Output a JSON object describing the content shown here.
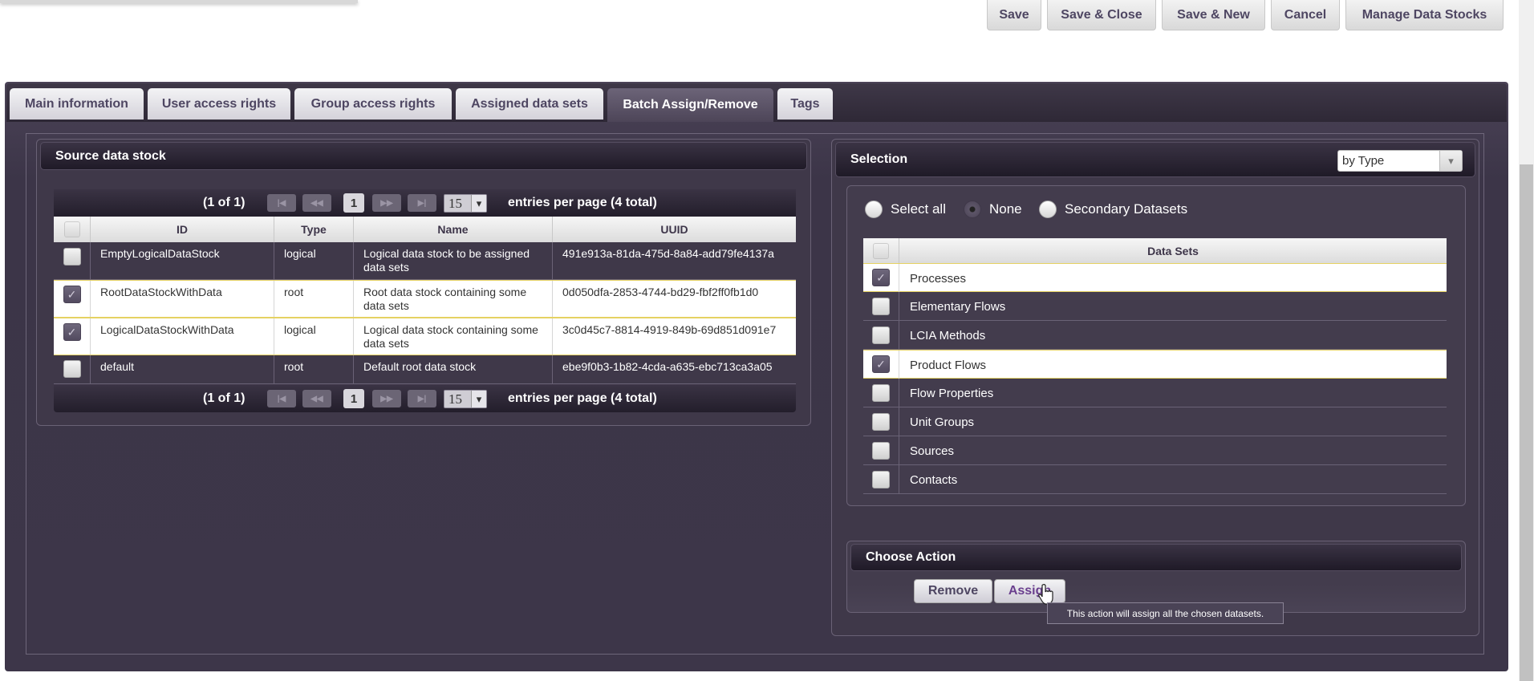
{
  "toolbar": {
    "save": "Save",
    "save_close": "Save & Close",
    "save_new": "Save & New",
    "cancel": "Cancel",
    "manage": "Manage Data Stocks"
  },
  "tabs": [
    "Main information",
    "User access rights",
    "Group access rights",
    "Assigned data sets",
    "Batch Assign/Remove",
    "Tags"
  ],
  "active_tab": "Batch Assign/Remove",
  "source": {
    "title": "Source data stock",
    "pager": {
      "status": "(1 of 1)",
      "page": "1",
      "per_page": "15",
      "summary": "entries per page (4 total)"
    },
    "columns": [
      "ID",
      "Type",
      "Name",
      "UUID"
    ],
    "rows": [
      {
        "id": "EmptyLogicalDataStock",
        "type": "logical",
        "name": "Logical data stock to be assigned data sets",
        "uuid": "491e913a-81da-475d-8a84-add79fe4137a",
        "checked": false
      },
      {
        "id": "RootDataStockWithData",
        "type": "root",
        "name": "Root data stock containing some data sets",
        "uuid": "0d050dfa-2853-4744-bd29-fbf2ff0fb1d0",
        "checked": true
      },
      {
        "id": "LogicalDataStockWithData",
        "type": "logical",
        "name": "Logical data stock containing some data sets",
        "uuid": "3c0d45c7-8814-4919-849b-69d851d091e7",
        "checked": true
      },
      {
        "id": "default",
        "type": "root",
        "name": "Default root data stock",
        "uuid": "ebe9f0b3-1b82-4cda-a635-ebc713ca3a05",
        "checked": false
      }
    ]
  },
  "selection": {
    "title": "Selection",
    "mode": "by Type",
    "radios": [
      {
        "label": "Select all",
        "on": false
      },
      {
        "label": "None",
        "on": true
      },
      {
        "label": "Secondary Datasets",
        "on": false
      }
    ],
    "column": "Data Sets",
    "items": [
      {
        "label": "Processes",
        "checked": true
      },
      {
        "label": "Elementary Flows",
        "checked": false
      },
      {
        "label": "LCIA Methods",
        "checked": false
      },
      {
        "label": "Product Flows",
        "checked": true
      },
      {
        "label": "Flow Properties",
        "checked": false
      },
      {
        "label": "Unit Groups",
        "checked": false
      },
      {
        "label": "Sources",
        "checked": false
      },
      {
        "label": "Contacts",
        "checked": false
      }
    ]
  },
  "action": {
    "title": "Choose Action",
    "remove": "Remove",
    "assign": "Assign",
    "tooltip": "This action will assign all the chosen datasets."
  },
  "icons": {
    "check": "✓",
    "first": "|◀",
    "prev": "◀◀",
    "next": "▶▶",
    "last": "▶|",
    "dropdown": "▾"
  }
}
